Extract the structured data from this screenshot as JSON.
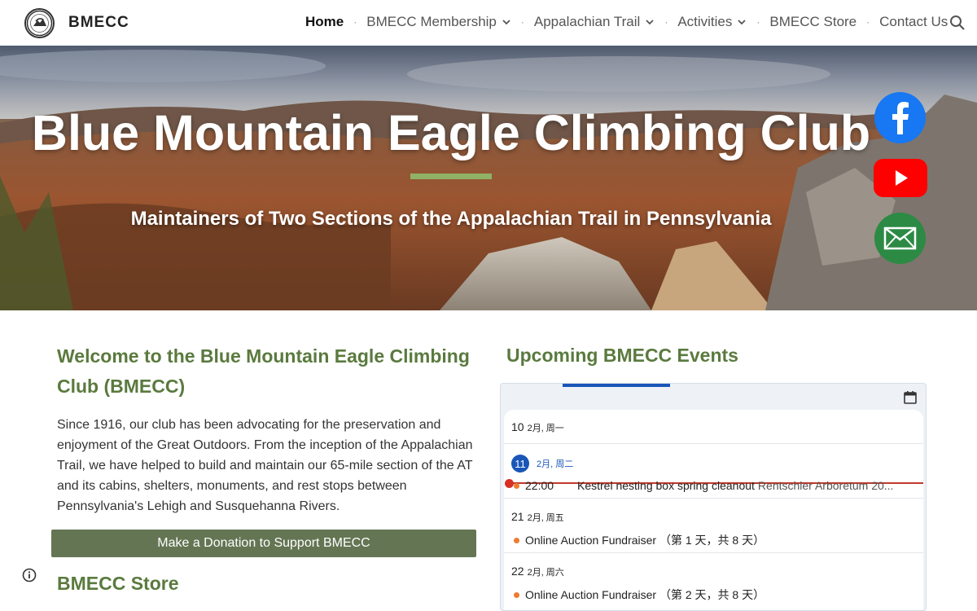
{
  "header": {
    "site_name": "BMECC",
    "nav": [
      {
        "label": "Home",
        "active": true,
        "dropdown": false
      },
      {
        "label": "BMECC Membership",
        "active": false,
        "dropdown": true
      },
      {
        "label": "Appalachian Trail",
        "active": false,
        "dropdown": true
      },
      {
        "label": "Activities",
        "active": false,
        "dropdown": true
      },
      {
        "label": "BMECC Store",
        "active": false,
        "dropdown": false
      },
      {
        "label": "Contact Us",
        "active": false,
        "dropdown": false
      }
    ],
    "separator": "·",
    "search_icon": "search-icon"
  },
  "hero": {
    "title": "Blue Mountain Eagle Climbing Club",
    "subtitle": "Maintainers of Two Sections of the Appalachian Trail in Pennsylvania",
    "accent_color": "#8fb266",
    "social": [
      {
        "icon": "facebook-icon",
        "color": "#1877f2"
      },
      {
        "icon": "youtube-icon",
        "color": "#ff0000"
      },
      {
        "icon": "email-icon",
        "color": "#2c8a44"
      }
    ]
  },
  "main": {
    "welcome_heading": "Welcome to the Blue Mountain Eagle Climbing Club (BMECC)",
    "welcome_text": "Since 1916, our club has been advocating for the preservation and enjoyment of the Great Outdoors. From the inception of the Appalachian Trail, we have helped to build and maintain our 65-mile section of the AT and its cabins, shelters, monuments, and rest stops between Pennsylvania's Lehigh and Susquehanna Rivers.",
    "donate_label": "Make a Donation to Support BMECC",
    "store_heading": "BMECC Store",
    "heading_color": "#5a7a3e",
    "button_color": "#647553"
  },
  "events": {
    "heading": "Upcoming BMECC Events",
    "days": [
      {
        "num": "10",
        "meta": "2月, 周一",
        "today": false,
        "events": []
      },
      {
        "num": "11",
        "meta": "2月, 周二",
        "today": true,
        "events": [
          {
            "time": "22:00",
            "title": "Kestrel nesting box spring cleanout",
            "location": "Rentschler Arboretum 20..."
          }
        ]
      },
      {
        "num": "21",
        "meta": "2月, 周五",
        "today": false,
        "events": [
          {
            "time": "",
            "title": "Online Auction Fundraiser （第 1 天，共 8 天）",
            "location": ""
          }
        ]
      },
      {
        "num": "22",
        "meta": "2月, 周六",
        "today": false,
        "events": [
          {
            "time": "",
            "title": "Online Auction Fundraiser （第 2 天，共 8 天）",
            "location": ""
          }
        ]
      }
    ],
    "accent_color": "#1a56b8",
    "event_dot_color": "#f07a30",
    "now_line_color": "#c0392b"
  }
}
